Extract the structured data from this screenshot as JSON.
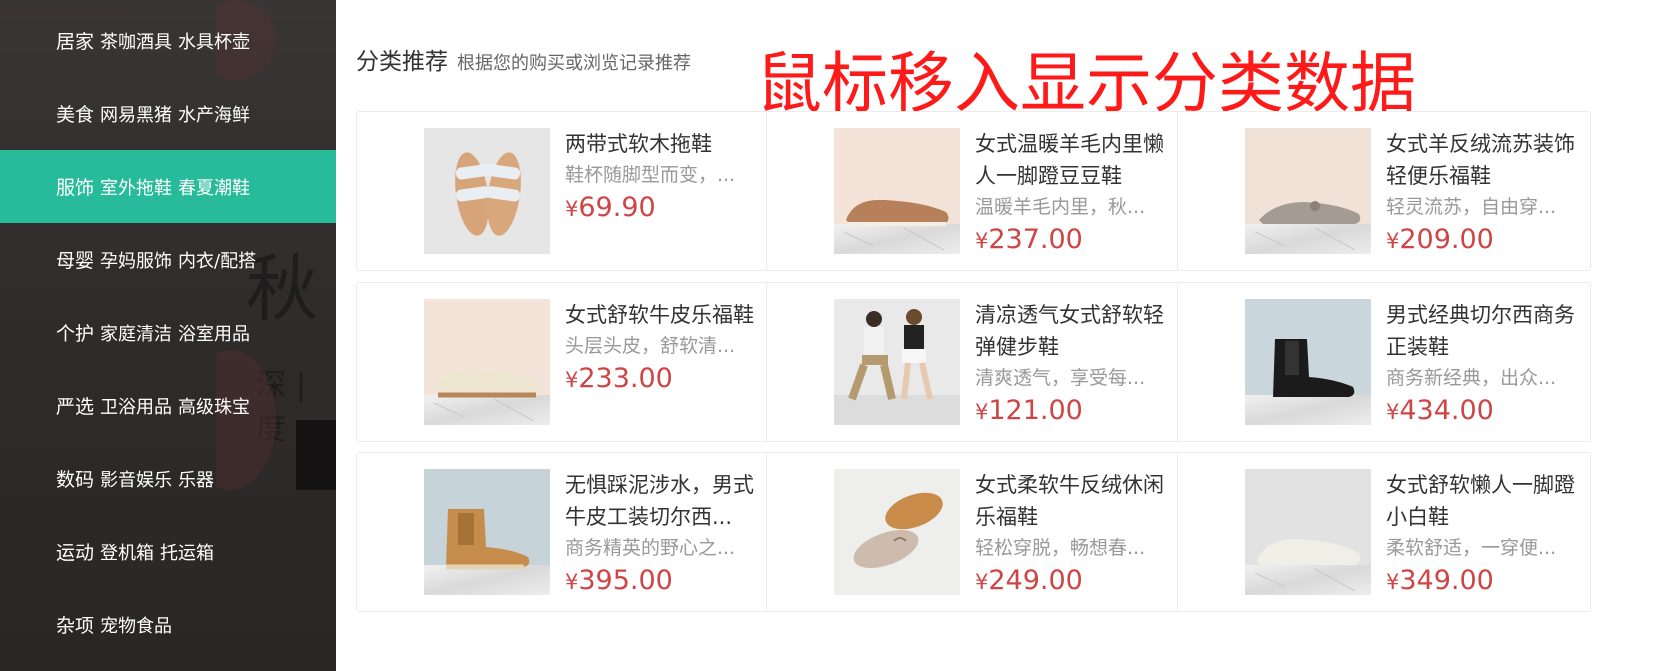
{
  "sidebar": {
    "items": [
      {
        "main": "居家",
        "subs": [
          "茶咖酒具",
          "水具杯壶"
        ],
        "active": false
      },
      {
        "main": "美食",
        "subs": [
          "网易黑猪",
          "水产海鲜"
        ],
        "active": false
      },
      {
        "main": "服饰",
        "subs": [
          "室外拖鞋",
          "春夏潮鞋"
        ],
        "active": true
      },
      {
        "main": "母婴",
        "subs": [
          "孕妈服饰",
          "内衣/配搭"
        ],
        "active": false
      },
      {
        "main": "个护",
        "subs": [
          "家庭清洁",
          "浴室用品"
        ],
        "active": false
      },
      {
        "main": "严选",
        "subs": [
          "卫浴用品",
          "高级珠宝"
        ],
        "active": false
      },
      {
        "main": "数码",
        "subs": [
          "影音娱乐",
          "乐器"
        ],
        "active": false
      },
      {
        "main": "运动",
        "subs": [
          "登机箱",
          "托运箱"
        ],
        "active": false
      },
      {
        "main": "杂项",
        "subs": [
          "宠物食品"
        ],
        "active": false
      }
    ],
    "background_text": {
      "big": "秋",
      "small": "深|度"
    }
  },
  "panel": {
    "title": "分类推荐",
    "subtitle": "根据您的购买或浏览记录推荐",
    "overlay_note": "鼠标移入显示分类数据",
    "overlay_color": "#ff1a1a"
  },
  "products": [
    {
      "name": "两带式软木拖鞋",
      "desc": "鞋杯随脚型而变，...",
      "currency": "¥",
      "price": "69.90",
      "image": "sandal"
    },
    {
      "name": "女式温暖羊毛内里懒人一脚蹬豆豆鞋",
      "desc": "温暖羊毛内里，秋...",
      "currency": "¥",
      "price": "237.00",
      "image": "loafer-brown"
    },
    {
      "name": "女式羊反绒流苏装饰轻便乐福鞋",
      "desc": "轻灵流苏，自由穿...",
      "currency": "¥",
      "price": "209.00",
      "image": "loafer-grey"
    },
    {
      "name": "女式舒软牛皮乐福鞋",
      "desc": "头层头皮，舒软清...",
      "currency": "¥",
      "price": "233.00",
      "image": "slipon-cream"
    },
    {
      "name": "清凉透气女式舒软轻弹健步鞋",
      "desc": "清爽透气，享受每...",
      "currency": "¥",
      "price": "121.00",
      "image": "models"
    },
    {
      "name": "男式经典切尔西商务正装鞋",
      "desc": "商务新经典，出众...",
      "currency": "¥",
      "price": "434.00",
      "image": "boot-black"
    },
    {
      "name": "无惧踩泥涉水，男式牛皮工装切尔西...",
      "desc": "商务精英的野心之...",
      "currency": "¥",
      "price": "395.00",
      "image": "boot-tan"
    },
    {
      "name": "女式柔软牛反绒休闲乐福鞋",
      "desc": "轻松穿脱，畅想春...",
      "currency": "¥",
      "price": "249.00",
      "image": "moccasins"
    },
    {
      "name": "女式舒软懒人一脚蹬小白鞋",
      "desc": "柔软舒适，一穿便...",
      "currency": "¥",
      "price": "349.00",
      "image": "sneaker-white"
    }
  ],
  "colors": {
    "accent": "#27ba9b",
    "price": "#cf4444",
    "sidebar_bg": "#2f2b2b"
  }
}
